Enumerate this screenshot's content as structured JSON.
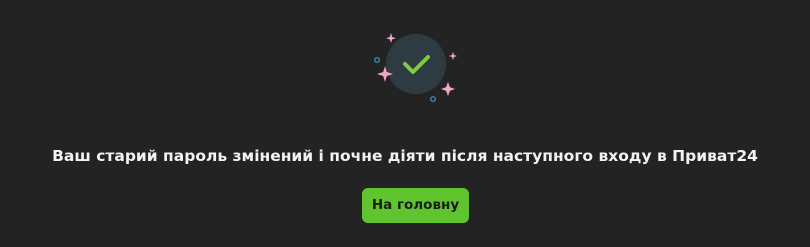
{
  "success": {
    "icon": "checkmark-success-icon",
    "message": "Ваш старий пароль змінений і почне діяти після наступного входу в Приват24"
  },
  "actions": {
    "home_label": "На головну"
  },
  "colors": {
    "background": "#232323",
    "icon_circle": "#2f3b42",
    "checkmark": "#7ecb3f",
    "sparkle": "#f3a7c7",
    "dot": "#3a9bd8",
    "button": "#5fc42d",
    "text": "#f2f2f2"
  }
}
